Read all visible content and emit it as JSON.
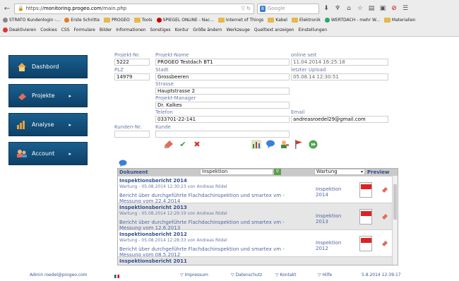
{
  "browser": {
    "url_prefix": "https://",
    "url_host": "monitoring.progeo.com",
    "url_path": "/main.php",
    "search_placeholder": "Google",
    "bookmarks": [
      "STRATO Kundenlogin -...",
      "Erste Schritte",
      "PROGEO",
      "Tools",
      "SPIEGEL ONLINE - Nac...",
      "Internet of Things",
      "Kabel",
      "Elektronik",
      "WERTDACH - mehr W...",
      "Materialien"
    ],
    "tools": [
      "Deaktivieren",
      "Cookies",
      "CSS",
      "Formulare",
      "Bilder",
      "Informationen",
      "Sonstiges",
      "Kontur",
      "Größe ändern",
      "Werkzeuge",
      "Quelltext anzeigen",
      "Einstellungen"
    ]
  },
  "sidebar": {
    "items": [
      {
        "label": "Dashbord"
      },
      {
        "label": "Projekte"
      },
      {
        "label": "Analyse"
      },
      {
        "label": "Account"
      }
    ]
  },
  "form": {
    "projekt_nr_label": "Projekt-Nr.",
    "projekt_nr": "5222",
    "projekt_name_label": "Projekt-Name",
    "projekt_name": "PROGEO Testdach BT1",
    "online_seit_label": "online seit",
    "online_seit": "11.04.2014 16:25:18",
    "plz_label": "PLZ",
    "plz": "14979",
    "stadt_label": "Stadt",
    "stadt": "Grossbeeren",
    "letzter_upload_label": "letzter Upload",
    "letzter_upload": "05.08.14 12:30:51",
    "strasse_label": "Strasse",
    "strasse": "Hauptstrasse 2",
    "manager_label": "Projekt-Manager",
    "manager": "Dr. Kalkes",
    "telefon_label": "Telefon",
    "telefon": "033701-22-141",
    "email_label": "Email",
    "email": "andreasroedel29@gmail.com",
    "kunden_nr_label": "Kunden-Nr.",
    "kunden_nr": "",
    "kunde_label": "Kunde",
    "kunde": ""
  },
  "documents": {
    "col_dokument": "Dokument",
    "filter_value": "Inspektion",
    "select_value": "Wartung",
    "col_preview": "Preview",
    "rows": [
      {
        "title": "Inspektionsbericht 2014",
        "meta": "Wartung - 05.08.2014 12:30:23 von Andreas Rödel",
        "text": "Bericht über durchgeführte Flachdachinspektion und smartex vm - Messung vom 22.4.2014",
        "type": "Inspektion 2014"
      },
      {
        "title": "Inspektionsbericht 2013",
        "meta": "Wartung - 05.08.2014 12:29:19 von Andreas Rödel",
        "text": "Bericht über durchgeführte Flachdachinspektion und smartex vm - Messung vom 12.6.2013",
        "type": "Inspektion 2013"
      },
      {
        "title": "Inspektionsbericht 2012",
        "meta": "Wartung - 05.08.2014 12:28:33 von Andreas Rödel",
        "text": "Bericht über durchgeführte Flachdachinspektion und smartex vm - Messung vom 08.5.2012",
        "type": "Inspektion 2012"
      },
      {
        "title": "Inspektionsbericht 2011",
        "meta": "",
        "text": "",
        "type": ""
      }
    ]
  },
  "footer": {
    "admin": "Admin roedel@progeo.com",
    "impressum": "▽ Impressum",
    "datenschutz": "▽ Datenschutz",
    "kontakt": "▽ Kontakt",
    "hilfe": "▽ Hilfe",
    "datetime": "5.8.2014 12:39:17"
  }
}
